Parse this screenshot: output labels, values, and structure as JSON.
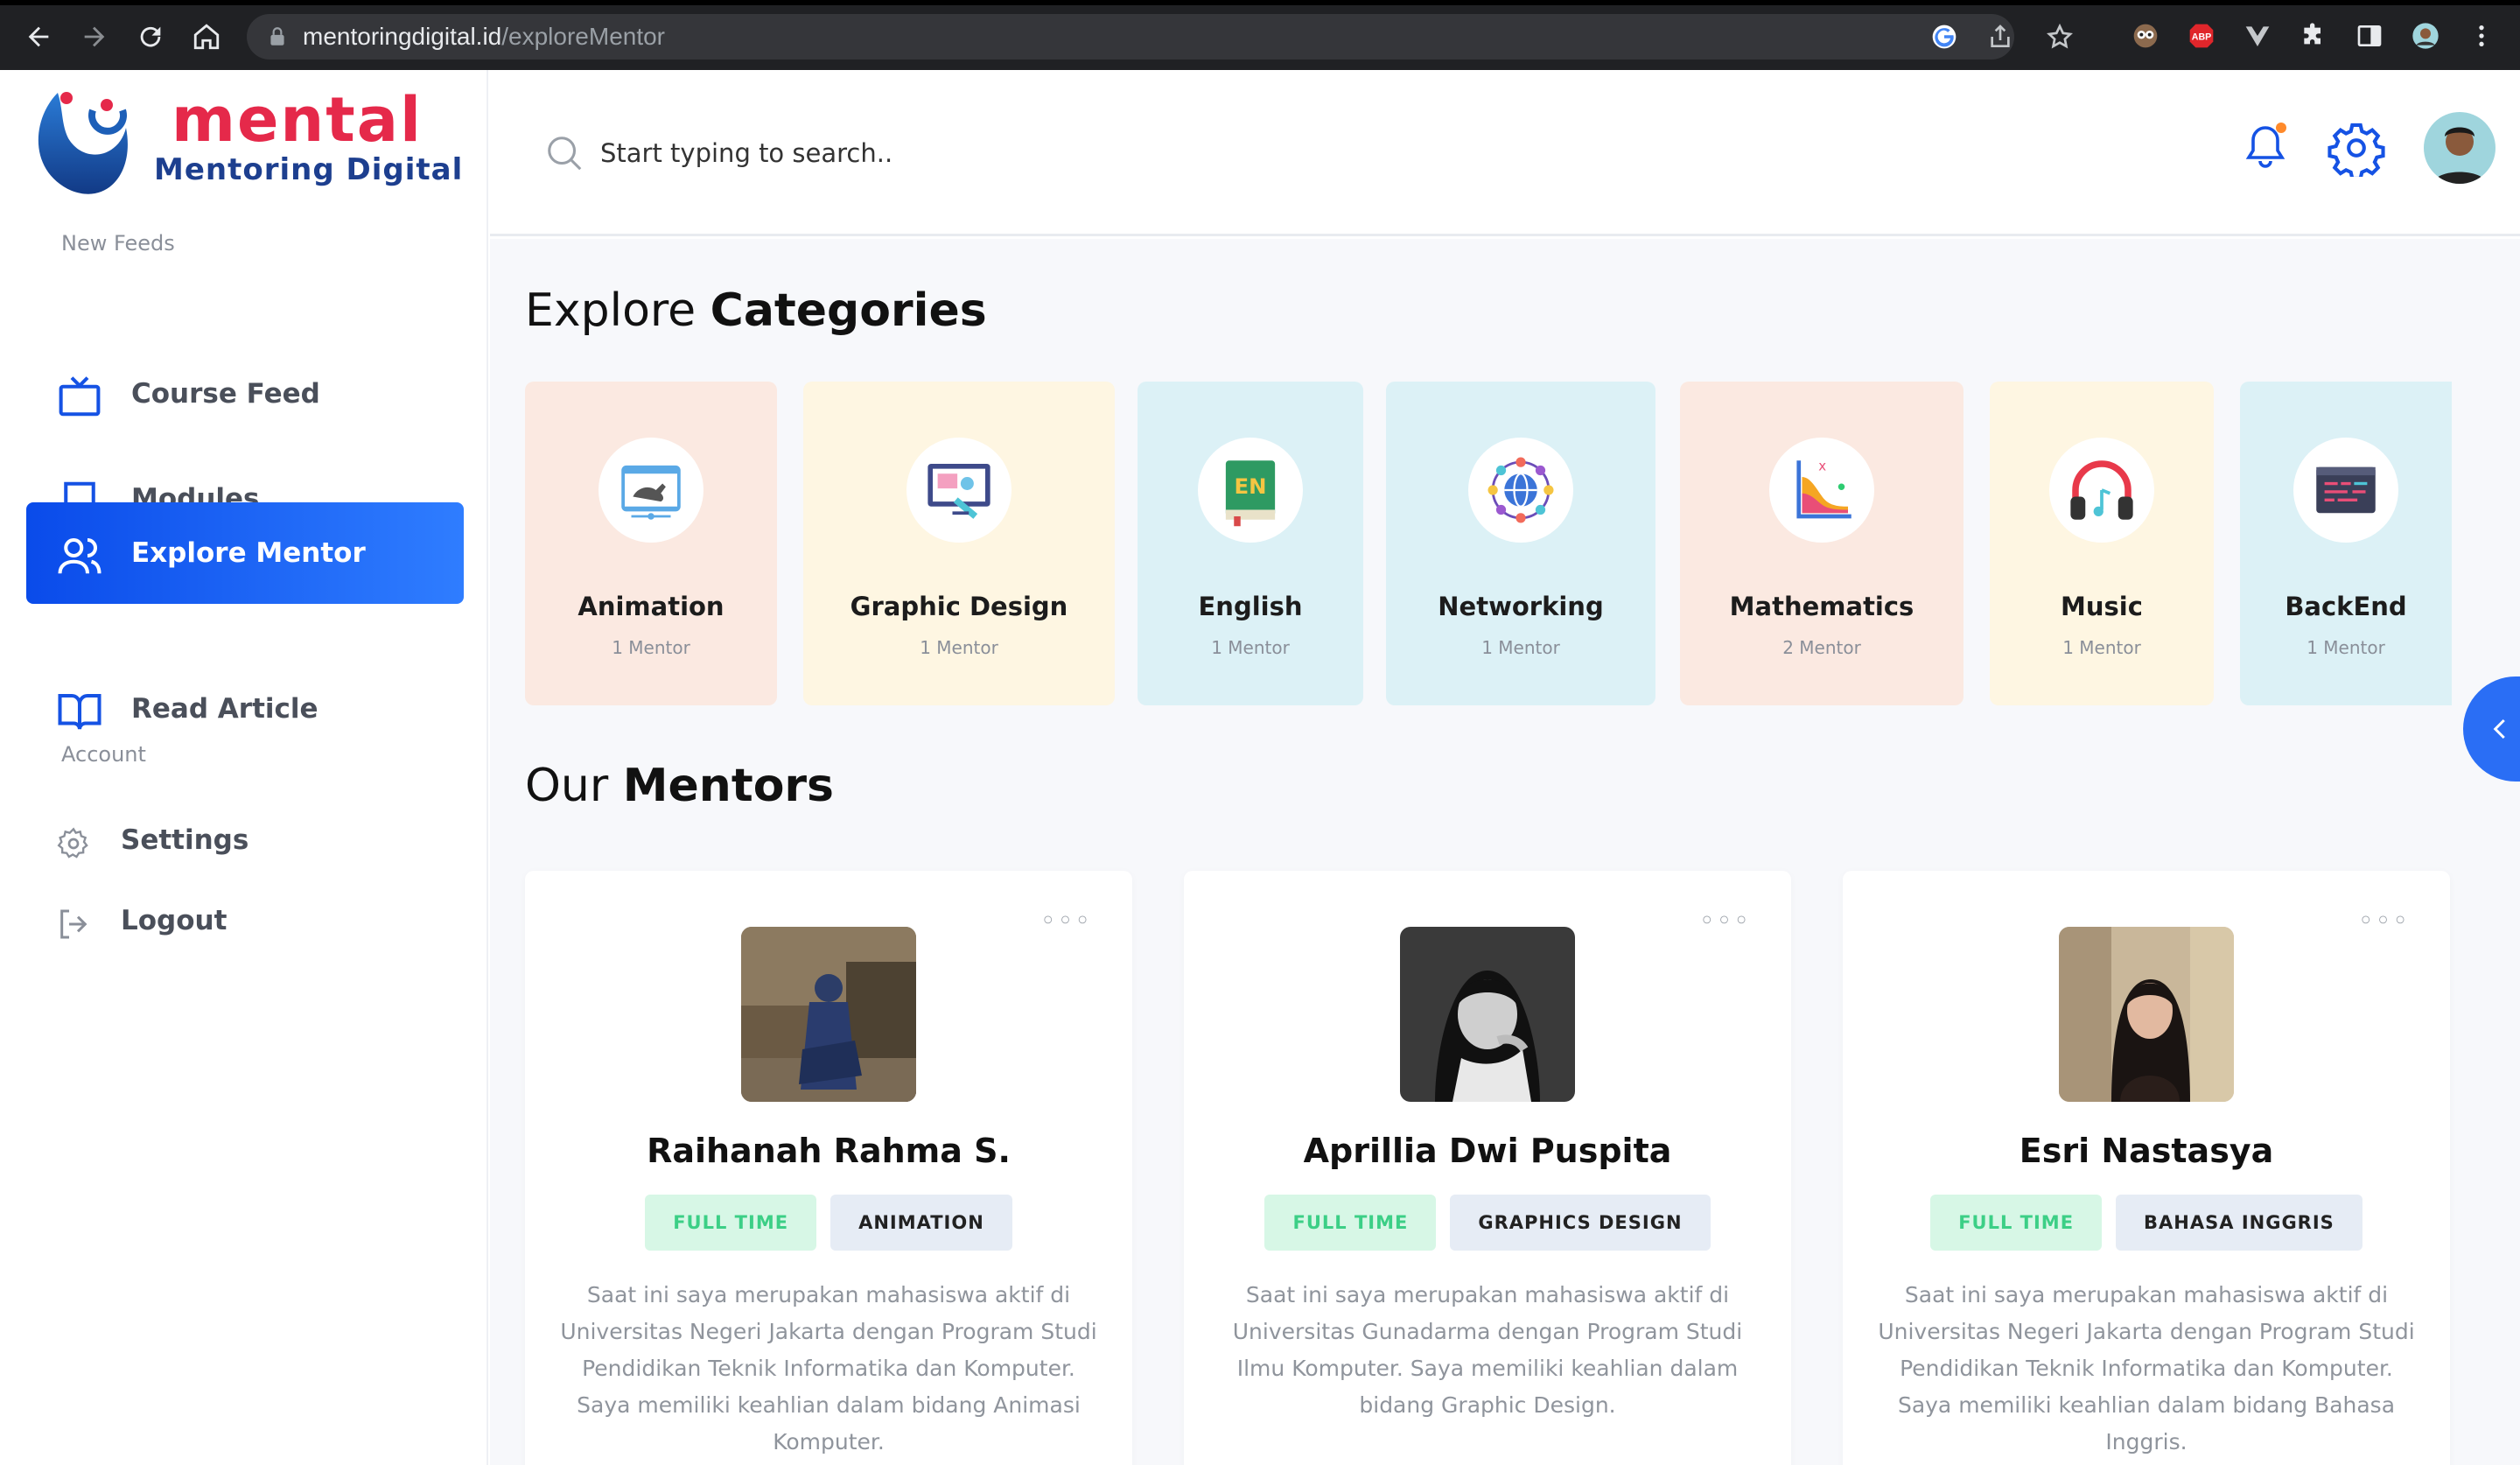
{
  "browser": {
    "url_host": "mentoringdigital.id",
    "url_path": "/exploreMentor",
    "extension_abp": "ABP"
  },
  "brand": {
    "name": "mental",
    "subtitle": "Mentoring Digital",
    "accent": "#e5294a",
    "primary": "#1d3f8f"
  },
  "sidebar": {
    "section_feeds": "New Feeds",
    "items": [
      {
        "label": "Course Feed",
        "icon": "tv-icon"
      },
      {
        "label": "Modules",
        "icon": "book-icon"
      },
      {
        "label": "Explore Mentor",
        "icon": "users-icon",
        "active": true
      },
      {
        "label": "Read Article",
        "icon": "open-book-icon"
      }
    ],
    "section_account": "Account",
    "account_items": [
      {
        "label": "Settings",
        "icon": "gear-icon"
      },
      {
        "label": "Logout",
        "icon": "logout-icon"
      }
    ]
  },
  "header": {
    "search_placeholder": "Start typing to search.."
  },
  "categories": {
    "title_light": "Explore ",
    "title_bold": "Categories",
    "items": [
      {
        "name": "Animation",
        "count": "1 Mentor",
        "bg": "#fbe9e1"
      },
      {
        "name": "Graphic Design",
        "count": "1 Mentor",
        "bg": "#fef6e2"
      },
      {
        "name": "English",
        "count": "1 Mentor",
        "bg": "#dcf1f6"
      },
      {
        "name": "Networking",
        "count": "1 Mentor",
        "bg": "#dcf1f6"
      },
      {
        "name": "Mathematics",
        "count": "2 Mentor",
        "bg": "#fbe9e1"
      },
      {
        "name": "Music",
        "count": "1 Mentor",
        "bg": "#fef6e2"
      },
      {
        "name": "BackEnd",
        "count": "1 Mentor",
        "bg": "#dcf1f6"
      }
    ]
  },
  "mentors": {
    "title_light": "Our ",
    "title_bold": "Mentors",
    "items": [
      {
        "name": "Raihanah Rahma S.",
        "type": "FULL TIME",
        "category": "ANIMATION",
        "desc": "Saat ini saya merupakan mahasiswa aktif di Universitas Negeri Jakarta dengan Program Studi Pendidikan Teknik Informatika dan Komputer. Saya memiliki keahlian dalam bidang Animasi Komputer."
      },
      {
        "name": "Aprillia Dwi Puspita",
        "type": "FULL TIME",
        "category": "GRAPHICS DESIGN",
        "desc": "Saat ini saya merupakan mahasiswa aktif di Universitas Gunadarma dengan Program Studi Ilmu Komputer. Saya memiliki keahlian dalam bidang Graphic Design."
      },
      {
        "name": "Esri Nastasya",
        "type": "FULL TIME",
        "category": "BAHASA INGGRIS",
        "desc": "Saat ini saya merupakan mahasiswa aktif di Universitas Negeri Jakarta dengan Program Studi Pendidikan Teknik Informatika dan Komputer. Saya memiliki keahlian dalam bidang Bahasa Inggris."
      }
    ]
  }
}
